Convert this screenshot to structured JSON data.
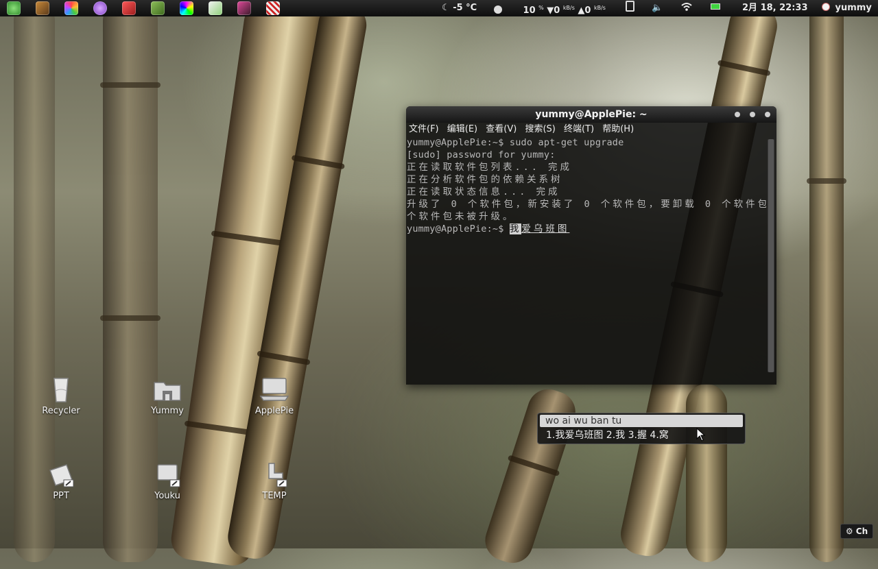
{
  "top_panel": {
    "weather": "-5 °C",
    "cpu": "10",
    "cpu_unit": "%",
    "net_down": "0",
    "net_up": "0",
    "net_unit": "kB/s",
    "datetime": "2月 18, 22:33",
    "user": "yummy"
  },
  "terminal": {
    "title": "yummy@ApplePie: ~",
    "menu": [
      "文件(F)",
      "编辑(E)",
      "查看(V)",
      "搜索(S)",
      "终端(T)",
      "帮助(H)"
    ],
    "lines": [
      "yummy@ApplePie:~$ sudo apt-get upgrade",
      "[sudo] password for yummy:",
      "正在读取软件包列表... 完成",
      "正在分析软件包的依赖关系树",
      "正在读取状态信息... 完成",
      "升级了 0 个软件包，新安装了 0 个软件包，要卸载 0 个软件包，",
      "个软件包未被升级。"
    ],
    "prompt": "yummy@ApplePie:~$ ",
    "preedit_first": "我",
    "preedit_rest": "爱乌班图"
  },
  "ime": {
    "input": "wo ai wu ban tu",
    "candidates": "1.我爱乌班图 2.我 3.握 4.窝"
  },
  "desktop_icons": [
    {
      "label": "Recycler",
      "icon": "trash-icon"
    },
    {
      "label": "Yummy",
      "icon": "home-folder-icon"
    },
    {
      "label": "ApplePie",
      "icon": "computer-icon"
    },
    {
      "label": "PPT",
      "icon": "ppt-shortcut-icon"
    },
    {
      "label": "Youku",
      "icon": "youku-shortcut-icon"
    },
    {
      "label": "TEMP",
      "icon": "temp-shortcut-icon"
    }
  ],
  "keyboard_button": {
    "label": "Ch",
    "icon": "gear-icon"
  },
  "launcher_icons": [
    "deepin-icon",
    "contacts-icon",
    "photos-icon",
    "chat-icon",
    "game-icon",
    "system-monitor-icon",
    "color-picker-icon",
    "notes-icon",
    "media-icon",
    "music-icon"
  ],
  "colors": {
    "panel": "#0e0e0e",
    "terminal_bg": "#0a0a0a",
    "battery": "#3fd43f"
  }
}
